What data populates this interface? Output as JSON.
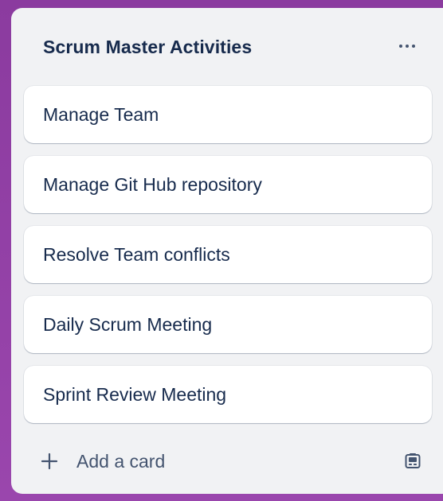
{
  "list": {
    "title": "Scrum Master Activities",
    "menu_icon": "more-horizontal-icon",
    "cards": [
      {
        "label": "Manage Team"
      },
      {
        "label": "Manage Git Hub repository"
      },
      {
        "label": "Resolve Team conflicts"
      },
      {
        "label": "Daily Scrum Meeting"
      },
      {
        "label": "Sprint Review Meeting"
      }
    ],
    "footer": {
      "add_card_label": "Add a card",
      "add_card_icon": "plus-icon",
      "template_icon": "card-template-icon"
    }
  },
  "colors": {
    "board_background": "#8e3fa1",
    "list_background": "#f1f2f4",
    "card_background": "#ffffff",
    "title_text": "#172b4d",
    "secondary_text": "#44546f"
  }
}
